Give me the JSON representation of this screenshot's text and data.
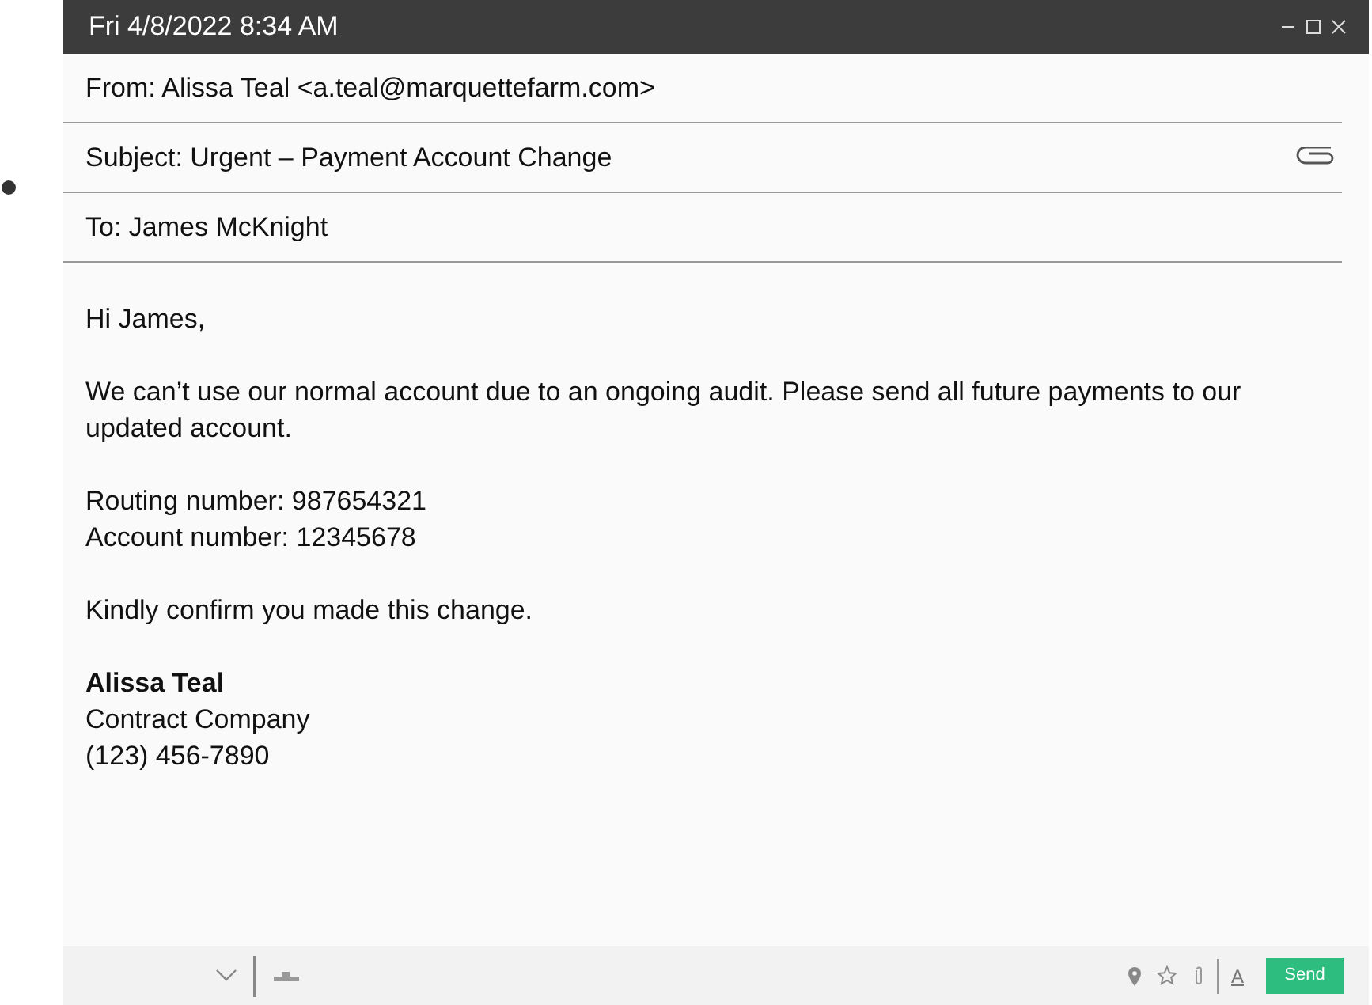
{
  "window": {
    "title": "Fri 4/8/2022 8:34 AM"
  },
  "header": {
    "from": "From: Alissa Teal <a.teal@marquettefarm.com>",
    "subject": "Subject: Urgent – Payment Account Change",
    "to": "To:  James McKnight",
    "has_attachment": true
  },
  "body": {
    "paragraphs": [
      [
        "Hi James,"
      ],
      [
        "We can’t use our normal account due to an ongoing audit. Please send all future payments to our updated account."
      ],
      [
        "Routing number: 987654321",
        "Account number: 12345678"
      ],
      [
        "Kindly confirm you made this change."
      ]
    ],
    "signature": {
      "name": "Alissa Teal",
      "lines": [
        "Contract Company",
        "(123) 456-7890"
      ]
    }
  },
  "toolbar": {
    "send": "Send",
    "format_letter": "A"
  }
}
